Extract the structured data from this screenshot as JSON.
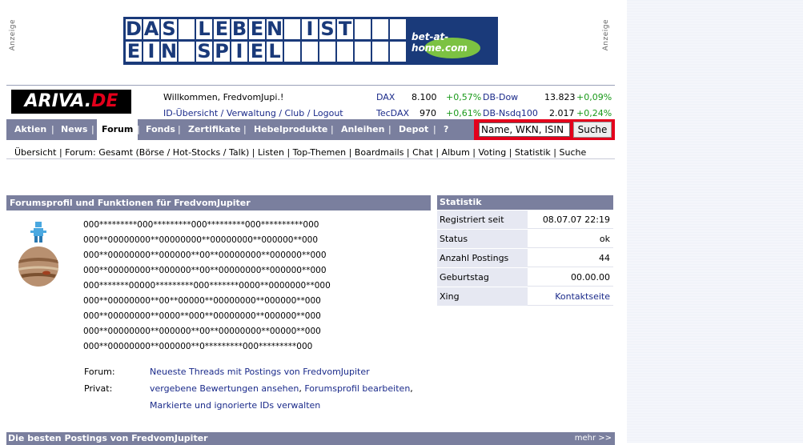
{
  "ads": {
    "label_left": "Anzeige",
    "label_right": "Anzeige",
    "banner_row1": [
      "D",
      "A",
      "S",
      " ",
      "L",
      "E",
      "B",
      "E",
      "N",
      " ",
      "I",
      "S",
      "T",
      " ",
      " ",
      " "
    ],
    "banner_row2": [
      "E",
      "I",
      "N",
      " ",
      "S",
      "P",
      "I",
      "E",
      "L",
      " ",
      " ",
      " ",
      " ",
      " ",
      " ",
      " "
    ],
    "brand": "bet-at-home.com"
  },
  "header": {
    "logo_main": "ARIVA.",
    "logo_de": "DE",
    "welcome": "Willkommen, FredvomJupi.!",
    "links": [
      "ID-Übersicht",
      "Verwaltung",
      "Club",
      "Logout"
    ],
    "indices": [
      {
        "name": "DAX",
        "value": "8.100",
        "change": "+0,57%"
      },
      {
        "name": "DB-Dow",
        "value": "13.823",
        "change": "+0,09%"
      },
      {
        "name": "TecDAX",
        "value": "970",
        "change": "+0,61%"
      },
      {
        "name": "DB-Nsdq100",
        "value": "2.017",
        "change": "+0,24%"
      }
    ]
  },
  "nav": {
    "items": [
      "Aktien",
      "News",
      "Forum",
      "Fonds",
      "Zertifikate",
      "Hebelprodukte",
      "Anleihen",
      "Depot",
      "?"
    ],
    "active": "Forum",
    "search_value": "Name, WKN, ISIN",
    "search_button": "Suche"
  },
  "subnav": "Übersicht | Forum: Gesamt (Börse / Hot-Stocks / Talk) | Listen | Top-Themen | Boardmails | Chat | Album | Voting | Statistik | Suche",
  "profile": {
    "title": "Forumsprofil und Funktionen für FredvomJupiter",
    "ascii": [
      "000*********000*********000*********000**********000",
      "000**00000000**00000000**00000000**000000**000",
      "000**00000000**000000**00**00000000**000000**000",
      "000**00000000**000000**00**00000000**000000**000",
      "000*******00000*********000*******0000**0000000**000",
      "000**00000000**00**00000**00000000**000000**000",
      "000**00000000**0000**000**00000000**000000**000",
      "000**00000000**000000**00**00000000**00000**000",
      "000**00000000**000000**0*********000*********000"
    ],
    "forum_label": "Forum:",
    "forum_link": "Neueste Threads mit Postings von FredvomJupiter",
    "privat_label": "Privat:",
    "privat_link1": "vergebene Bewertungen ansehen",
    "privat_link2": "Forumsprofil bearbeiten",
    "privat_link3": "Markierte und ignorierte IDs verwalten"
  },
  "stats": {
    "title": "Statistik",
    "rows": [
      {
        "k": "Registriert seit",
        "v": "08.07.07 22:19"
      },
      {
        "k": "Status",
        "v": "ok"
      },
      {
        "k": "Anzahl Postings",
        "v": "44"
      },
      {
        "k": "Geburtstag",
        "v": "00.00.00"
      },
      {
        "k": "Xing",
        "v": "Kontaktseite"
      }
    ]
  },
  "best": {
    "title": "Die besten Postings von FredvomJupiter",
    "more": "mehr >>"
  },
  "colors": {
    "accent": "#e3001b",
    "bar": "#7a7f9e",
    "link": "#1a2a8a",
    "positive": "#1a9a1a"
  }
}
